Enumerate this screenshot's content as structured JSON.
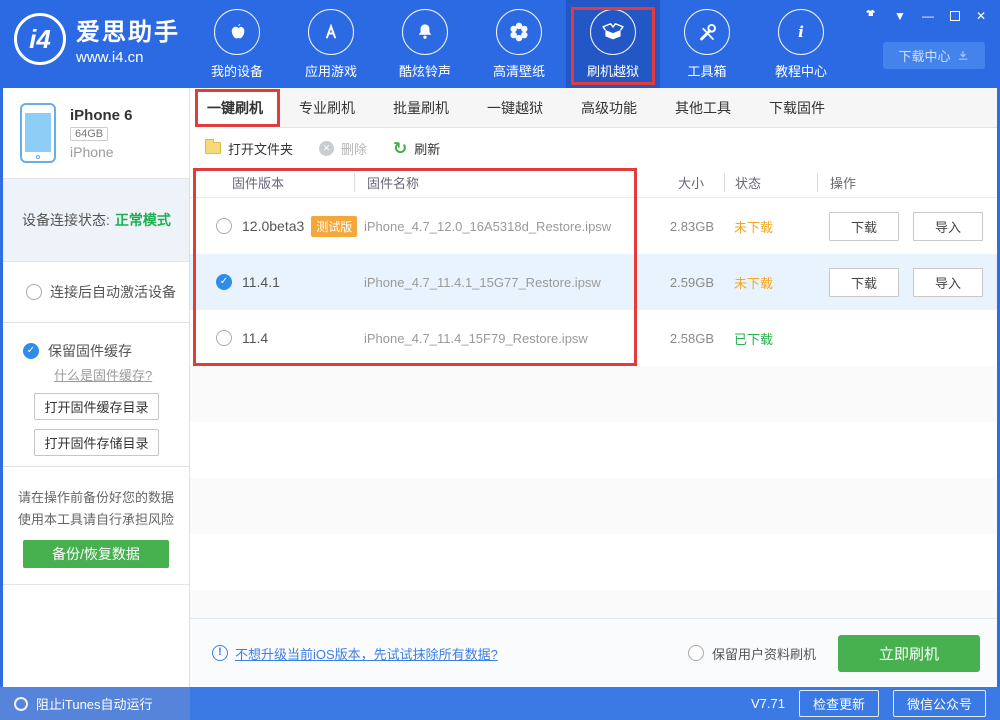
{
  "header": {
    "logo_badge": "i4",
    "app_name": "爱思助手",
    "app_url": "www.i4.cn",
    "download_center": "下载中心",
    "nav": {
      "items": [
        {
          "label": "我的设备"
        },
        {
          "label": "应用游戏"
        },
        {
          "label": "酷炫铃声"
        },
        {
          "label": "高清壁纸"
        },
        {
          "label": "刷机越狱"
        },
        {
          "label": "工具箱"
        },
        {
          "label": "教程中心"
        }
      ]
    }
  },
  "sidebar": {
    "device": {
      "name": "iPhone 6",
      "capacity": "64GB",
      "type": "iPhone"
    },
    "connection": {
      "label": "设备连接状态:",
      "value": "正常模式"
    },
    "auto_activate": "连接后自动激活设备",
    "keep_cache": "保留固件缓存",
    "cache_link": "什么是固件缓存?",
    "open_cache_btn": "打开固件缓存目录",
    "open_storage_btn": "打开固件存储目录",
    "warning_line1": "请在操作前备份好您的数据",
    "warning_line2": "使用本工具请自行承担风险",
    "backup_btn": "备份/恢复数据",
    "block_itunes": "阻止iTunes自动运行"
  },
  "main": {
    "tabs": [
      "一键刷机",
      "专业刷机",
      "批量刷机",
      "一键越狱",
      "高级功能",
      "其他工具",
      "下载固件"
    ],
    "toolbar": {
      "open_folder": "打开文件夹",
      "delete": "删除",
      "refresh": "刷新"
    },
    "table": {
      "columns": [
        "固件版本",
        "固件名称",
        "大小",
        "状态",
        "操作"
      ],
      "action_labels": {
        "download": "下载",
        "import": "导入"
      },
      "rows": [
        {
          "version": "12.0beta3",
          "badge": "测试版",
          "name": "iPhone_4.7_12.0_16A5318d_Restore.ipsw",
          "size": "2.83GB",
          "status": "未下载",
          "selected": false
        },
        {
          "version": "11.4.1",
          "name": "iPhone_4.7_11.4.1_15G77_Restore.ipsw",
          "size": "2.59GB",
          "status": "未下载",
          "selected": true
        },
        {
          "version": "11.4",
          "name": "iPhone_4.7_11.4_15F79_Restore.ipsw",
          "size": "2.58GB",
          "status": "已下载",
          "selected": false
        }
      ]
    },
    "footer": {
      "erase_link": "不想升级当前iOS版本，先试试抹除所有数据?",
      "keep_data": "保留用户资料刷机",
      "flash_btn": "立即刷机"
    }
  },
  "statusbar": {
    "version": "V7.71",
    "check_update": "检查更新",
    "wechat": "微信公众号"
  },
  "colors": {
    "header_blue": "#2b6ae3",
    "selected_nav_blue": "#2357c6",
    "status_bar_blue": "#3b79e4",
    "green_button": "#46b14e",
    "green_status": "#26b14c",
    "orange_status": "#f5a623",
    "badge_orange": "#f5a73b",
    "link_blue": "#3d7fe3",
    "annotation_red": "#e13b3b",
    "selected_row_bg": "#e9f3fd"
  }
}
